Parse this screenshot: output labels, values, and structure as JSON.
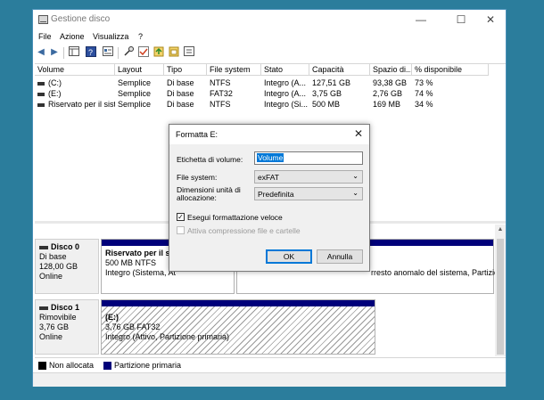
{
  "window": {
    "title": "Gestione disco",
    "minimize": "—",
    "maximize": "☐",
    "close": "✕"
  },
  "menu": [
    "File",
    "Azione",
    "Visualizza",
    "?"
  ],
  "table": {
    "headers": [
      "Volume",
      "Layout",
      "Tipo",
      "File system",
      "Stato",
      "Capacità",
      "Spazio di...",
      "% disponibile"
    ],
    "rows": [
      [
        "(C:)",
        "Semplice",
        "Di base",
        "NTFS",
        "Integro (A...",
        "127,51 GB",
        "93,38 GB",
        "73 %"
      ],
      [
        "(E:)",
        "Semplice",
        "Di base",
        "FAT32",
        "Integro (A...",
        "3,75 GB",
        "2,76 GB",
        "74 %"
      ],
      [
        "Riservato per il sist...",
        "Semplice",
        "Di base",
        "NTFS",
        "Integro (Si...",
        "500 MB",
        "169 MB",
        "34 %"
      ]
    ]
  },
  "disks": [
    {
      "name": "Disco 0",
      "type": "Di base",
      "size": "128,00 GB",
      "status": "Online",
      "partitions": [
        {
          "title": "Riservato per il si",
          "size": "500 MB NTFS",
          "status": "Integro (Sistema, At"
        },
        {
          "title": "",
          "size": "",
          "status": "rresto anomalo del sistema, Partizio"
        }
      ]
    },
    {
      "name": "Disco 1",
      "type": "Rimovibile",
      "size": "3,76 GB",
      "status": "Online",
      "partitions": [
        {
          "title": "(E:)",
          "size": "3,76 GB FAT32",
          "status": "Integro (Attivo, Partizione primaria)"
        }
      ]
    }
  ],
  "legend": [
    {
      "label": "Non allocata",
      "color": "#000000"
    },
    {
      "label": "Partizione primaria",
      "color": "#00007a"
    }
  ],
  "dialog": {
    "title": "Formatta E:",
    "close": "✕",
    "volume_label": "Etichetta di volume:",
    "volume_value": "Volume",
    "fs_label": "File system:",
    "fs_value": "exFAT",
    "alloc_label_1": "Dimensioni unità di",
    "alloc_label_2": "allocazione:",
    "alloc_value": "Predefinita",
    "quick_format": "Esegui formattazione veloce",
    "quick_checked": "✓",
    "compression": "Attiva compressione file e cartelle",
    "ok": "OK",
    "cancel": "Annulla"
  },
  "icons": {
    "back": "◀",
    "forward": "▶",
    "chevron": "⌄",
    "up": "▲",
    "down": "▼"
  }
}
